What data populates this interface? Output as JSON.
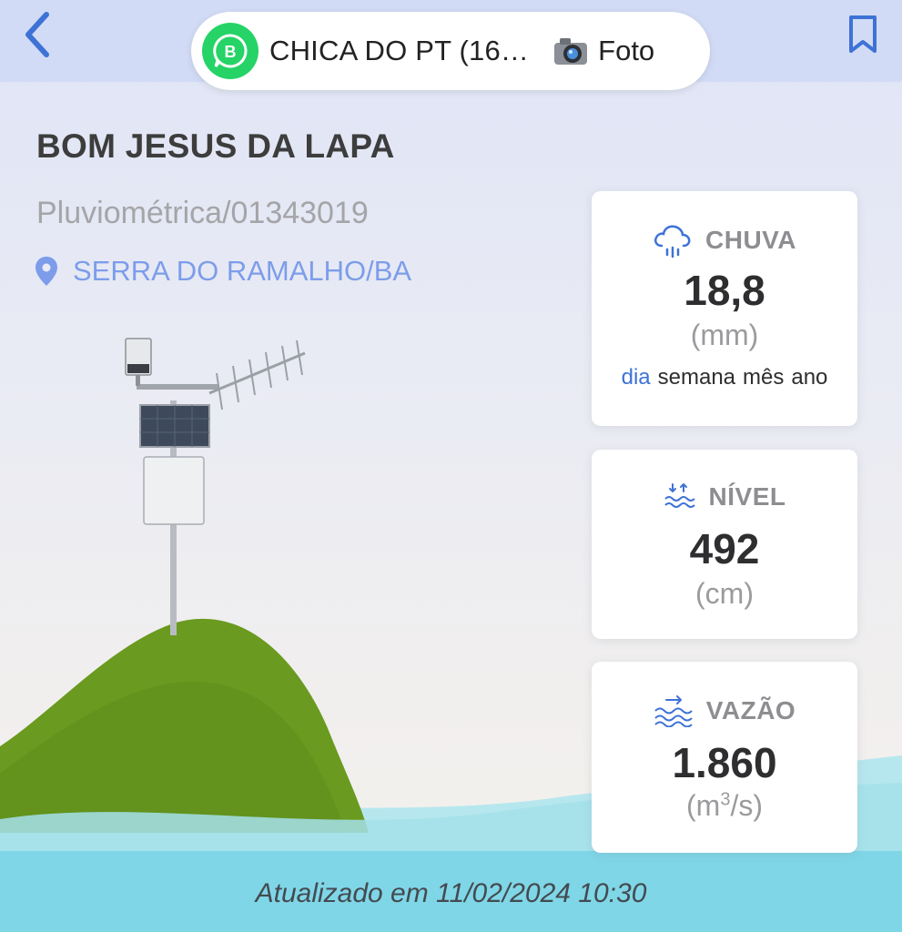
{
  "header": {
    "chat_title": "CHICA DO PT (16…",
    "chat_action": "Foto",
    "camera_emoji": "📷",
    "icons": {
      "back": "chevron-left-icon",
      "bookmark": "bookmark-icon",
      "whatsapp": "whatsapp-business-icon"
    }
  },
  "station": {
    "name": "BOM JESUS DA LAPA",
    "code": "Pluviométrica/01343019",
    "location": "SERRA DO RAMALHO/BA"
  },
  "cards": {
    "rain": {
      "label": "CHUVA",
      "value": "18,8",
      "unit": "(mm)",
      "periods": [
        "dia",
        "semana",
        "mês",
        "ano"
      ],
      "active_period": "dia"
    },
    "level": {
      "label": "NÍVEL",
      "value": "492",
      "unit": "(cm)"
    },
    "flow": {
      "label": "VAZÃO",
      "value": "1.860",
      "unit_pre": "(m",
      "unit_sup": "3",
      "unit_post": "/s)"
    }
  },
  "footer": {
    "updated": "Atualizado em 11/02/2024 10:30"
  },
  "colors": {
    "accent": "#3e72d6",
    "location": "#7d9dea",
    "hill": "#6a9a1f",
    "water": "#7fd6e6",
    "whatsapp": "#25d366"
  }
}
